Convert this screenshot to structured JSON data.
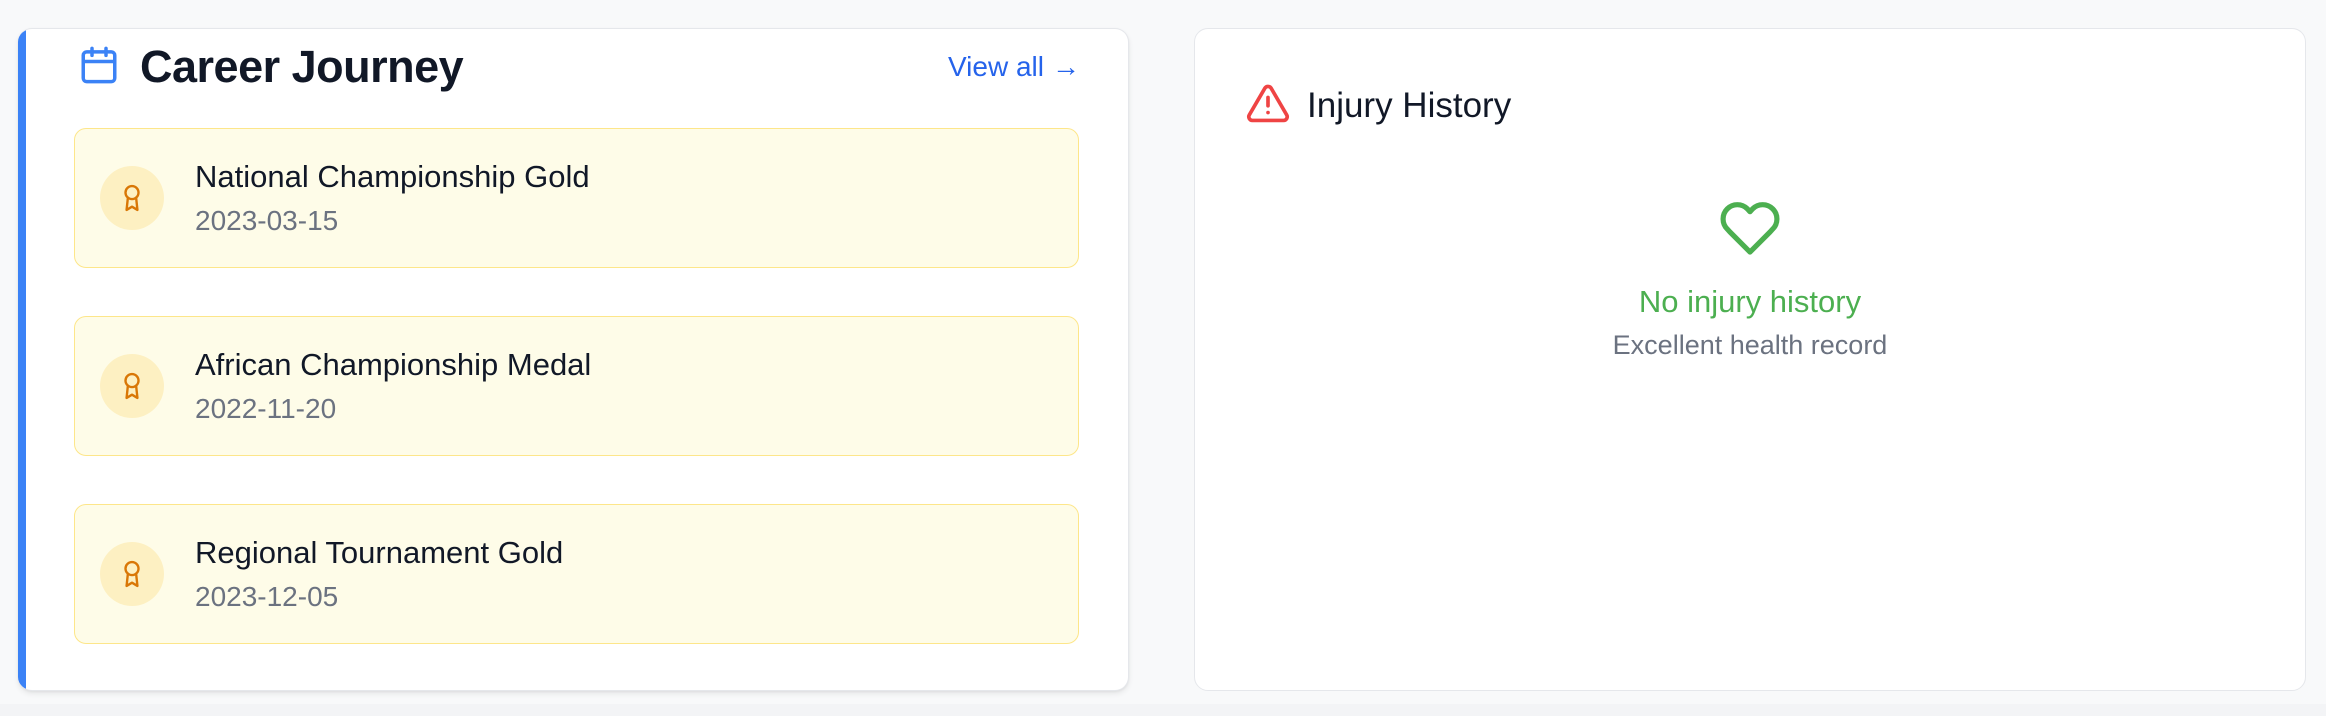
{
  "career": {
    "title": "Career Journey",
    "view_all_label": "View all",
    "view_all_arrow": "→",
    "accent_color": "#3b82f6",
    "icon": "calendar-icon",
    "achievements": [
      {
        "title": "National Championship Gold",
        "date": "2023-03-15",
        "icon": "award-icon"
      },
      {
        "title": "African Championship Medal",
        "date": "2022-11-20",
        "icon": "award-icon"
      },
      {
        "title": "Regional Tournament Gold",
        "date": "2023-12-05",
        "icon": "award-icon"
      }
    ]
  },
  "injury": {
    "title": "Injury History",
    "icon": "alert-triangle-icon",
    "icon_color": "#ef4444",
    "empty_icon": "heart-icon",
    "empty_color": "#4caf50",
    "empty_title": "No injury history",
    "empty_subtitle": "Excellent health record"
  }
}
